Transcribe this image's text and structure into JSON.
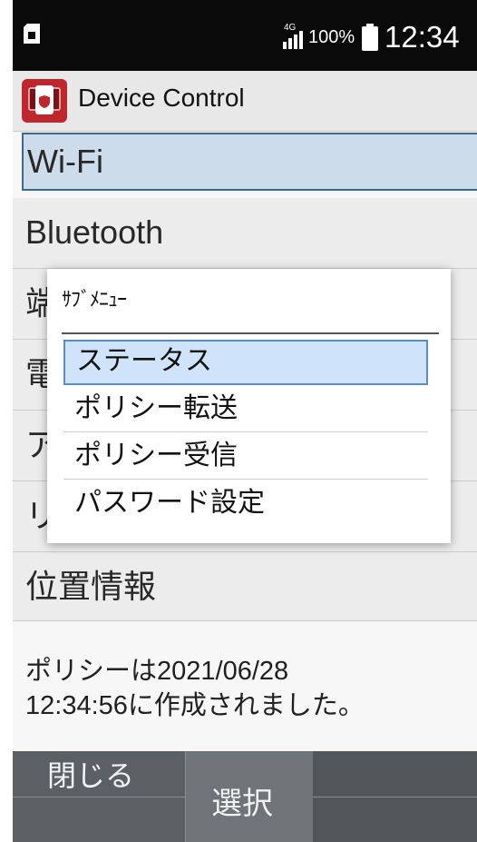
{
  "status_bar": {
    "network": "4G",
    "battery_percent": "100%",
    "time": "12:34"
  },
  "app": {
    "title": "Device Control",
    "icon": "device-control-app-icon"
  },
  "menu": {
    "items": [
      {
        "label": "Wi-Fi",
        "selected": true
      },
      {
        "label": "Bluetooth"
      },
      {
        "label": "端"
      },
      {
        "label": "電"
      },
      {
        "label": "ア"
      },
      {
        "label": "リ"
      },
      {
        "label": "位置情報"
      }
    ]
  },
  "footer": {
    "line1": "ポリシーは2021/06/28",
    "line2": "12:34:56に作成されました。"
  },
  "dialog": {
    "title": "ｻﾌﾞﾒﾆｭｰ",
    "items": [
      {
        "label": "ステータス",
        "selected": true
      },
      {
        "label": "ポリシー転送"
      },
      {
        "label": "ポリシー受信"
      },
      {
        "label": "パスワード設定"
      }
    ]
  },
  "softkeys": {
    "left": "閉じる",
    "center": "選択",
    "right": ""
  },
  "colors": {
    "selection_bg": "#d4e4f2",
    "selection_border": "#3f6c91",
    "dialog_selection_bg": "#cfe3fb",
    "softkey_bg": "#505659"
  }
}
